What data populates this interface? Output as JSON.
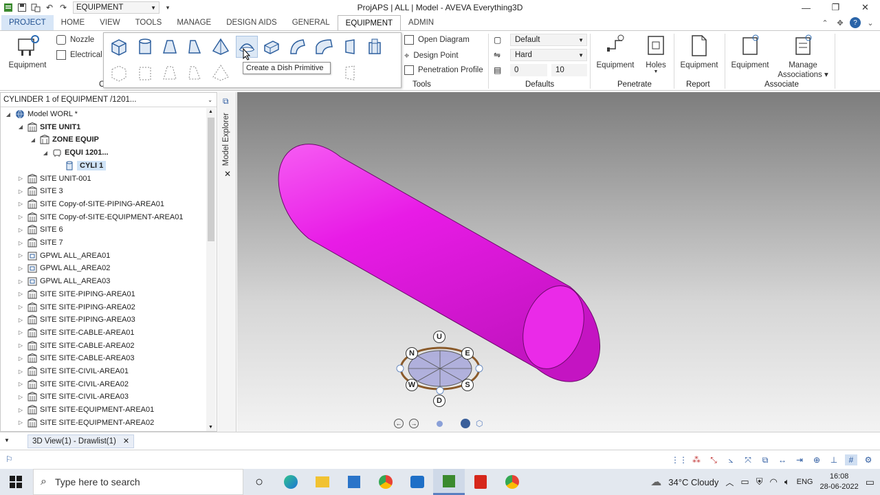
{
  "window": {
    "title": "ProjAPS | ALL | Model - AVEVA Everything3D",
    "quick_access_combo": "EQUIPMENT"
  },
  "tabs": [
    {
      "label": "PROJECT"
    },
    {
      "label": "HOME"
    },
    {
      "label": "VIEW"
    },
    {
      "label": "TOOLS"
    },
    {
      "label": "MANAGE"
    },
    {
      "label": "DESIGN AIDS"
    },
    {
      "label": "GENERAL"
    },
    {
      "label": "EQUIPMENT"
    },
    {
      "label": "ADMIN"
    }
  ],
  "ribbon": {
    "equipment_big": "Equipment",
    "nozzle": "Nozzle",
    "electrical": "Electrical",
    "create_group_fragment": "C",
    "tooltip": "Create a Dish Primitive",
    "tools": {
      "open_diagram": "Open Diagram",
      "design_point": "Design Point",
      "penetration_profile": "Penetration Profile",
      "label": "Tools"
    },
    "defaults": {
      "style": "Default",
      "hardness": "Hard",
      "value_a": "0",
      "value_b": "10",
      "label": "Defaults"
    },
    "penetrate": {
      "equipment": "Equipment",
      "holes": "Holes",
      "label": "Penetrate"
    },
    "report": {
      "equipment": "Equipment",
      "label": "Report"
    },
    "associate": {
      "equipment": "Equipment",
      "manage": "Manage",
      "associations": "Associations",
      "label": "Associate"
    }
  },
  "explorer": {
    "header": "CYLINDER 1 of EQUIPMENT /1201...",
    "side_label": "Model Explorer",
    "tree": [
      {
        "label": "Model WORL *",
        "indent": 0,
        "bold": false,
        "icon": "world-icon"
      },
      {
        "label": "SITE UNIT1",
        "indent": 1,
        "bold": true,
        "icon": "site-icon"
      },
      {
        "label": "ZONE EQUIP",
        "indent": 2,
        "bold": true,
        "icon": "zone-icon"
      },
      {
        "label": "EQUI 1201...",
        "indent": 3,
        "bold": true,
        "icon": "equipment-icon"
      },
      {
        "label": "CYLI 1",
        "indent": 4,
        "bold": true,
        "icon": "cylinder-icon",
        "selected": true
      },
      {
        "label": "SITE UNIT-001",
        "indent": 1,
        "bold": false,
        "icon": "site-icon"
      },
      {
        "label": "SITE 3",
        "indent": 1,
        "bold": false,
        "icon": "site-icon"
      },
      {
        "label": "SITE Copy-of-SITE-PIPING-AREA01",
        "indent": 1,
        "bold": false,
        "icon": "site-icon"
      },
      {
        "label": "SITE Copy-of-SITE-EQUIPMENT-AREA01",
        "indent": 1,
        "bold": false,
        "icon": "site-icon"
      },
      {
        "label": "SITE 6",
        "indent": 1,
        "bold": false,
        "icon": "site-icon"
      },
      {
        "label": "SITE 7",
        "indent": 1,
        "bold": false,
        "icon": "site-icon"
      },
      {
        "label": "GPWL ALL_AREA01",
        "indent": 1,
        "bold": false,
        "icon": "gpwl-icon"
      },
      {
        "label": "GPWL ALL_AREA02",
        "indent": 1,
        "bold": false,
        "icon": "gpwl-icon"
      },
      {
        "label": "GPWL ALL_AREA03",
        "indent": 1,
        "bold": false,
        "icon": "gpwl-icon"
      },
      {
        "label": "SITE SITE-PIPING-AREA01",
        "indent": 1,
        "bold": false,
        "icon": "site-icon"
      },
      {
        "label": "SITE SITE-PIPING-AREA02",
        "indent": 1,
        "bold": false,
        "icon": "site-icon"
      },
      {
        "label": "SITE SITE-PIPING-AREA03",
        "indent": 1,
        "bold": false,
        "icon": "site-icon"
      },
      {
        "label": "SITE SITE-CABLE-AREA01",
        "indent": 1,
        "bold": false,
        "icon": "site-icon"
      },
      {
        "label": "SITE SITE-CABLE-AREA02",
        "indent": 1,
        "bold": false,
        "icon": "site-icon"
      },
      {
        "label": "SITE SITE-CABLE-AREA03",
        "indent": 1,
        "bold": false,
        "icon": "site-icon"
      },
      {
        "label": "SITE SITE-CIVIL-AREA01",
        "indent": 1,
        "bold": false,
        "icon": "site-icon"
      },
      {
        "label": "SITE SITE-CIVIL-AREA02",
        "indent": 1,
        "bold": false,
        "icon": "site-icon"
      },
      {
        "label": "SITE SITE-CIVIL-AREA03",
        "indent": 1,
        "bold": false,
        "icon": "site-icon"
      },
      {
        "label": "SITE SITE-EQUIPMENT-AREA01",
        "indent": 1,
        "bold": false,
        "icon": "site-icon"
      },
      {
        "label": "SITE SITE-EQUIPMENT-AREA02",
        "indent": 1,
        "bold": false,
        "icon": "site-icon"
      }
    ]
  },
  "viewport": {
    "object_color": "#e81be6",
    "compass": {
      "u": "U",
      "d": "D",
      "n": "N",
      "e": "E",
      "s": "S",
      "w": "W"
    }
  },
  "view_tab": "3D View(1) - Drawlist(1)",
  "taskbar": {
    "search_placeholder": "Type here to search",
    "weather": "34°C  Cloudy",
    "lang": "ENG",
    "time": "16:08",
    "date": "28-06-2022"
  }
}
